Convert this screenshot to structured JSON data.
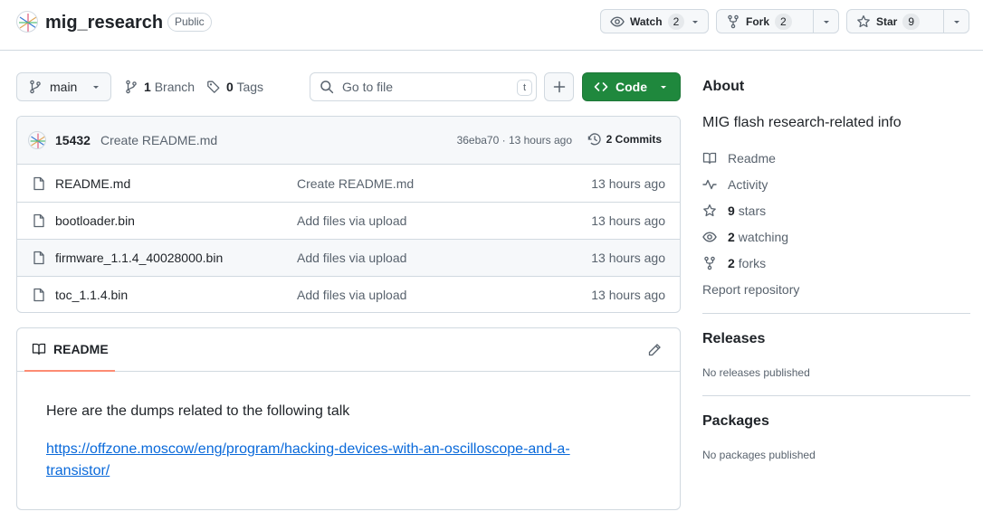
{
  "repo": {
    "name": "mig_research",
    "visibility": "Public"
  },
  "header_actions": {
    "watch": {
      "label": "Watch",
      "count": "2"
    },
    "fork": {
      "label": "Fork",
      "count": "2"
    },
    "star": {
      "label": "Star",
      "count": "9"
    }
  },
  "toolbar": {
    "branch": "main",
    "branches_count": "1",
    "branches_label": "Branch",
    "tags_count": "0",
    "tags_label": "Tags",
    "search_placeholder": "Go to file",
    "search_shortcut": "t",
    "code_label": "Code"
  },
  "latest_commit": {
    "author": "15432",
    "message": "Create README.md",
    "meta": "36eba70 · 13 hours ago",
    "commits_label": "2 Commits"
  },
  "files": [
    {
      "name": "README.md",
      "message": "Create README.md",
      "age": "13 hours ago"
    },
    {
      "name": "bootloader.bin",
      "message": "Add files via upload",
      "age": "13 hours ago"
    },
    {
      "name": "firmware_1.1.4_40028000.bin",
      "message": "Add files via upload",
      "age": "13 hours ago"
    },
    {
      "name": "toc_1.1.4.bin",
      "message": "Add files via upload",
      "age": "13 hours ago"
    }
  ],
  "readme": {
    "tab_label": "README",
    "text": "Here are the dumps related to the following talk",
    "link": "https://offzone.moscow/eng/program/hacking-devices-with-an-oscilloscope-and-a-transistor/"
  },
  "sidebar": {
    "about_title": "About",
    "description": "MIG flash research-related info",
    "readme_label": "Readme",
    "activity_label": "Activity",
    "stars_count": "9",
    "stars_label": "stars",
    "watching_count": "2",
    "watching_label": "watching",
    "forks_count": "2",
    "forks_label": "forks",
    "report_label": "Report repository",
    "releases_title": "Releases",
    "releases_empty": "No releases published",
    "packages_title": "Packages",
    "packages_empty": "No packages published"
  },
  "colors": {
    "accent_green": "#1f883d",
    "link_blue": "#0969da",
    "tab_underline": "#fd8c73",
    "border": "#d1d9e0"
  },
  "icons": [
    "repo-avatar",
    "eye-icon",
    "fork-icon",
    "star-icon",
    "branch-icon",
    "tag-icon",
    "search-icon",
    "plus-icon",
    "code-icon",
    "history-icon",
    "file-icon",
    "book-icon",
    "pencil-icon",
    "pulse-icon",
    "chevron-down-icon"
  ]
}
